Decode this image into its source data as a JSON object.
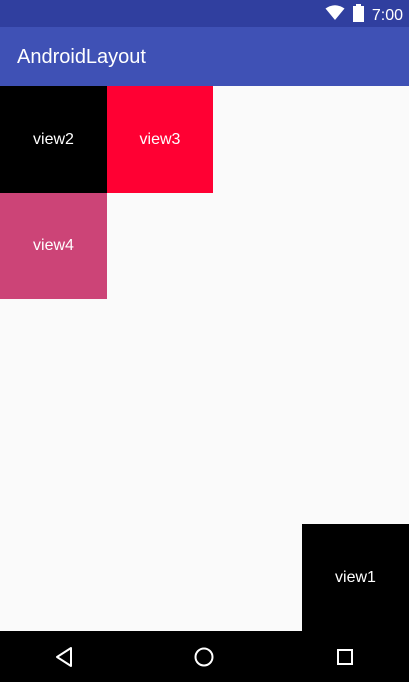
{
  "status_bar": {
    "time": "7:00",
    "icons": [
      "wifi-icon",
      "battery-icon"
    ],
    "color": "#303f9f"
  },
  "app_bar": {
    "title": "AndroidLayout",
    "color": "#3f51b5"
  },
  "views": [
    {
      "label": "view1",
      "color": "#000000"
    },
    {
      "label": "view2",
      "color": "#000000"
    },
    {
      "label": "view3",
      "color": "#ff0033"
    },
    {
      "label": "view4",
      "color": "#cc4477"
    }
  ],
  "nav_bar": {
    "buttons": [
      "back-icon",
      "home-icon",
      "recents-icon"
    ]
  }
}
